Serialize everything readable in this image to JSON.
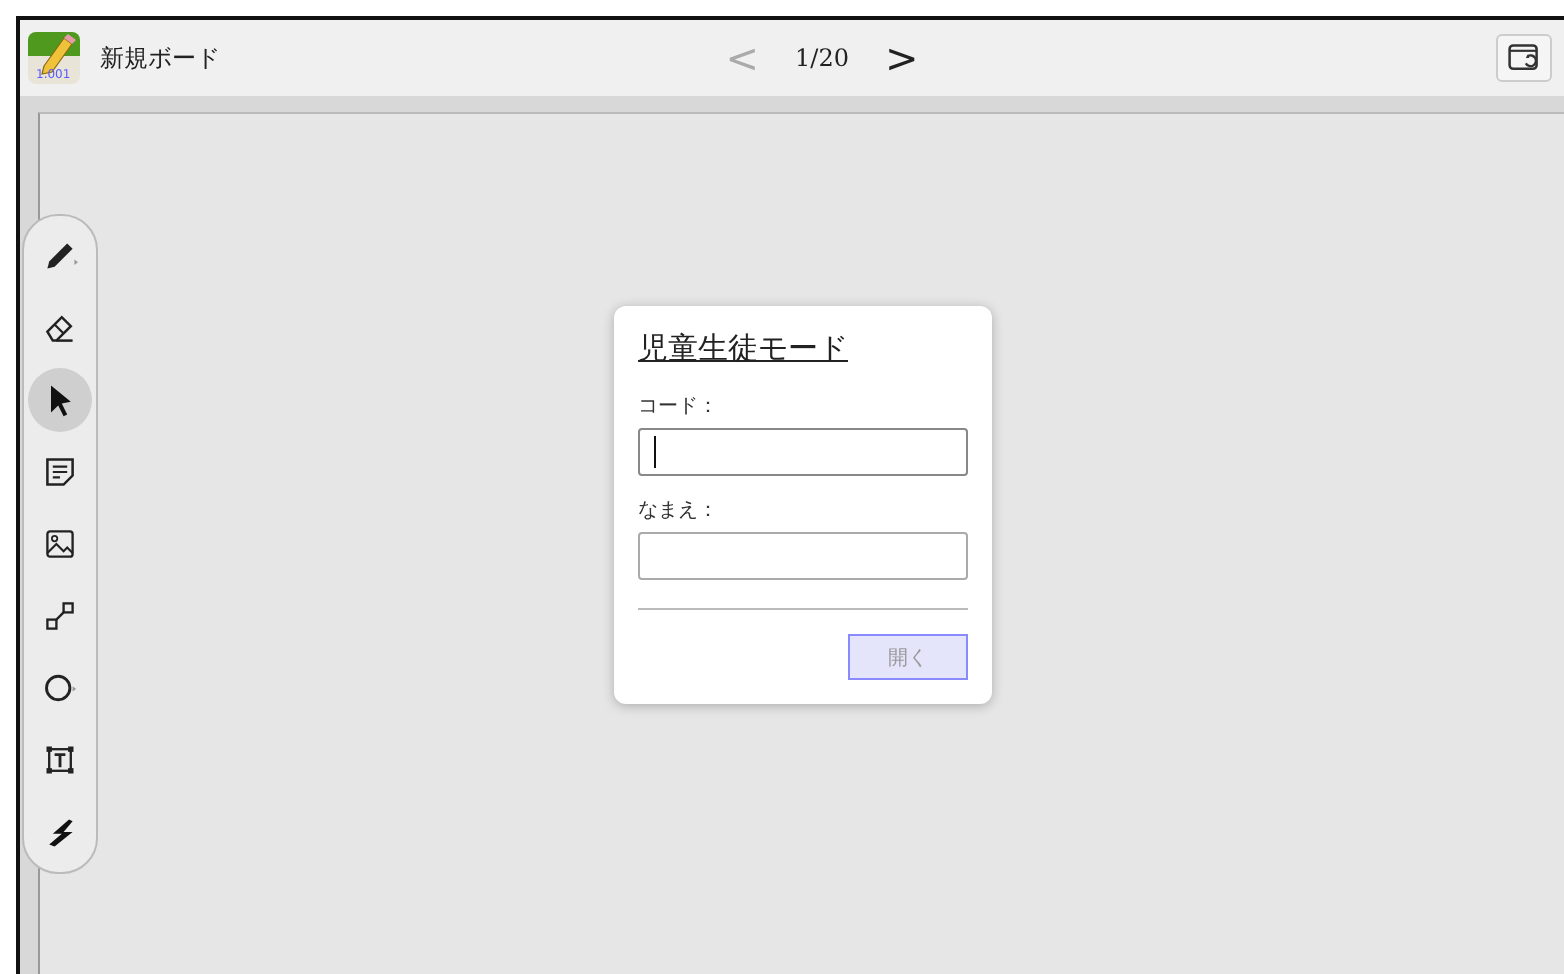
{
  "header": {
    "app_badge": "1.001",
    "title": "新規ボード",
    "prev": {
      "label": "<",
      "disabled": true
    },
    "page": "1/20",
    "next": {
      "label": ">",
      "disabled": false
    }
  },
  "tools": [
    {
      "kind": "pen",
      "selected": false
    },
    {
      "kind": "eraser",
      "selected": false
    },
    {
      "kind": "pointer",
      "selected": true
    },
    {
      "kind": "note",
      "selected": false
    },
    {
      "kind": "image",
      "selected": false
    },
    {
      "kind": "connector",
      "selected": false
    },
    {
      "kind": "shape",
      "selected": false
    },
    {
      "kind": "textbox",
      "selected": false
    },
    {
      "kind": "laser",
      "selected": false
    }
  ],
  "dialog": {
    "title": "児童生徒モード",
    "fields": [
      {
        "label": "コード：",
        "focused": true
      },
      {
        "label": "なまえ：",
        "focused": false
      }
    ],
    "button": {
      "label": "開く",
      "disabled": true
    }
  }
}
